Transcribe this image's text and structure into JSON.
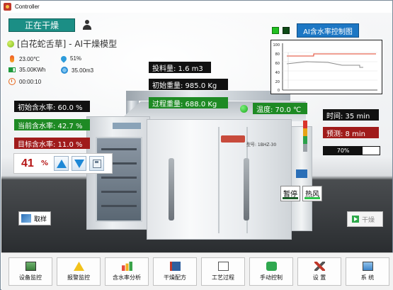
{
  "window": {
    "title": "Controller"
  },
  "status": {
    "label": "正在干燥"
  },
  "recipe": {
    "name": "[白花蛇舌草] - AI干燥模型"
  },
  "env": {
    "temperature": "23.00℃",
    "humidity": "51%",
    "energy": "35.00KWh",
    "water": "35.00m3",
    "elapsed": "00:00:10"
  },
  "moisture": {
    "initial": "初始含水率: 60.0 %",
    "current": "当前含水率: 42.7 %",
    "target": "目标含水率: 11.0 %"
  },
  "setpoint": {
    "value": "41",
    "unit": "%"
  },
  "weights": {
    "feed": "投料量: 1.6 m3",
    "initial": "初始重量: 985.0 Kg",
    "process": "过程重量: 688.0 Kg"
  },
  "process_temp": "温度: 70.0 ℃",
  "ai": {
    "label": "AI含水率控制图"
  },
  "trend": {
    "yticks": [
      "100",
      "80",
      "60",
      "40",
      "20",
      "0"
    ],
    "colors": {
      "red": "#e0402a",
      "gray": "#8c8c8c"
    }
  },
  "timing": {
    "time": "时间: 35 min",
    "predict": "预测: 8 min",
    "progress_text": "70%",
    "progress": 0.7
  },
  "buttons": {
    "pause": "暂停",
    "hotair": "热风",
    "sample": "取样",
    "dry": "干燥"
  },
  "nav": [
    {
      "label": "设备监控",
      "icon": "monitor-icon"
    },
    {
      "label": "报警监控",
      "icon": "warning-icon"
    },
    {
      "label": "含水率分析",
      "icon": "chart-icon"
    },
    {
      "label": "干燥配方",
      "icon": "book-icon"
    },
    {
      "label": "工艺过程",
      "icon": "process-icon"
    },
    {
      "label": "手动控制",
      "icon": "hand-icon"
    },
    {
      "label": "设 置",
      "icon": "tools-icon"
    },
    {
      "label": "系 统",
      "icon": "computer-icon"
    }
  ],
  "machine": {
    "model": "型号: 1BHZ-30"
  }
}
